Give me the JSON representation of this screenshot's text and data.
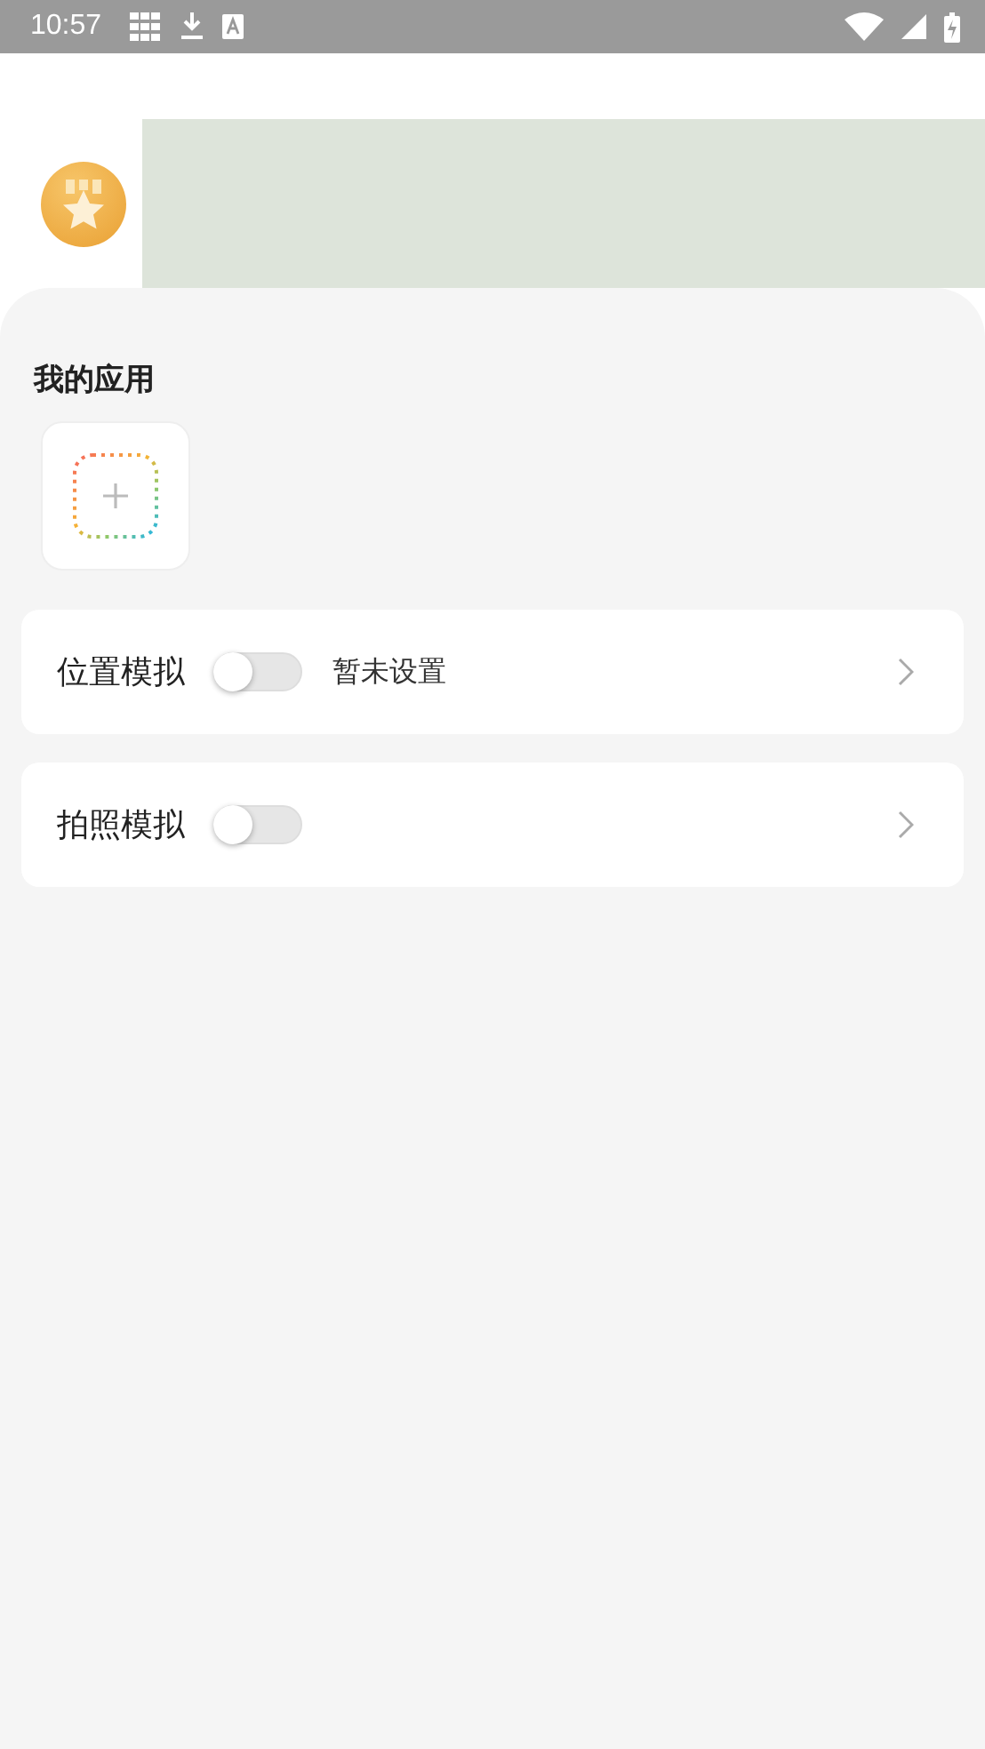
{
  "status_bar": {
    "time": "10:57"
  },
  "my_apps": {
    "title": "我的应用"
  },
  "settings": [
    {
      "label": "位置模拟",
      "on": false,
      "value": "暂未设置"
    },
    {
      "label": "拍照模拟",
      "on": false
    }
  ]
}
